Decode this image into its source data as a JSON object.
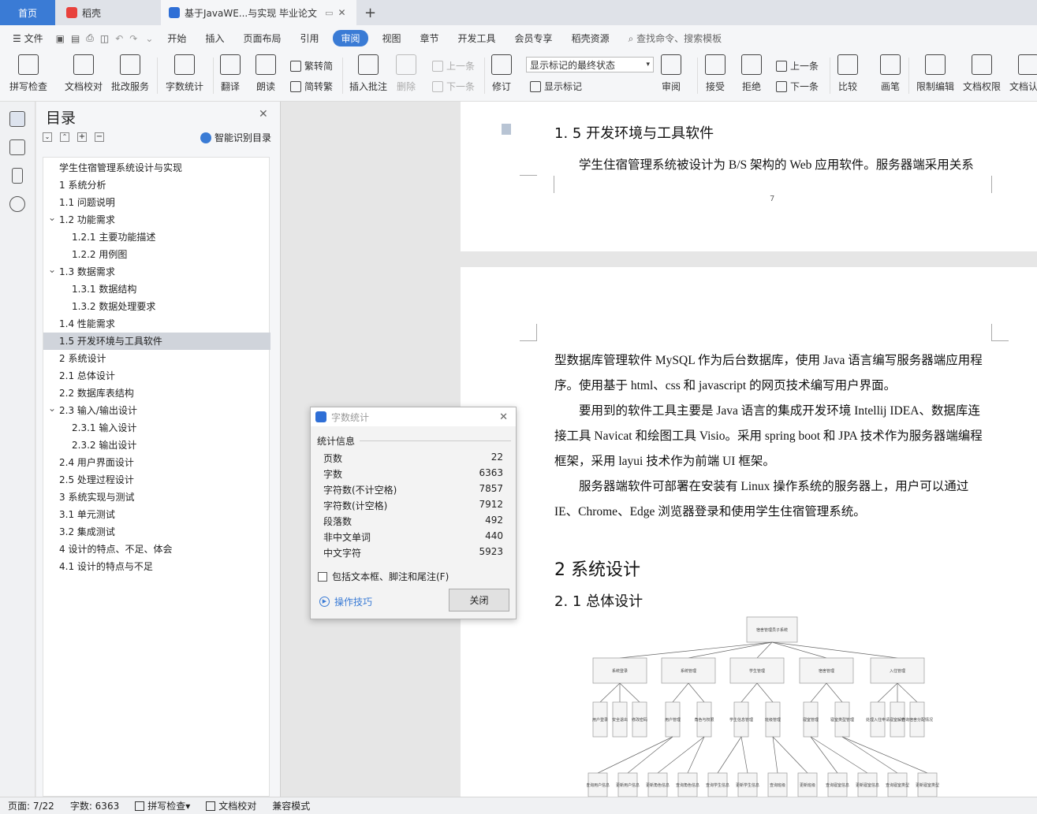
{
  "tabs": {
    "home": "首页",
    "app": "稻壳",
    "doc": "基于JavaWE...与实现 毕业论文"
  },
  "menu": {
    "file": "文件",
    "items": [
      "开始",
      "插入",
      "页面布局",
      "引用",
      "审阅",
      "视图",
      "章节",
      "开发工具",
      "会员专享",
      "稻壳资源"
    ],
    "active_index": 4,
    "search": "查找命令、搜索模板"
  },
  "toolbar": {
    "spell": "拼写检查",
    "proof": "文档校对",
    "batch": "批改服务",
    "wordcount": "字数统计",
    "translate": "翻译",
    "read": "朗读",
    "t2s": "繁转简",
    "s2t": "简转繁",
    "comment": "插入批注",
    "delete": "删除",
    "prev_c": "上一条",
    "next_c": "下一条",
    "revise": "修订",
    "markup_select": "显示标记的最终状态",
    "show_markup": "显示标记",
    "review": "审阅",
    "accept": "接受",
    "reject": "拒绝",
    "prev": "上一条",
    "next": "下一条",
    "compare": "比较",
    "pen": "画笔",
    "restrict": "限制编辑",
    "perm": "文档权限",
    "verify": "文档认证"
  },
  "toc": {
    "title": "目录",
    "smart": "智能识别目录",
    "selected_index": 10,
    "items": [
      {
        "text": "学生住宿管理系统设计与实现",
        "level": 0,
        "arrow": false
      },
      {
        "text": "1 系统分析",
        "level": 0,
        "arrow": false
      },
      {
        "text": "1.1 问题说明",
        "level": 0,
        "arrow": false
      },
      {
        "text": "1.2 功能需求",
        "level": 0,
        "arrow": true
      },
      {
        "text": "1.2.1 主要功能描述",
        "level": 1,
        "arrow": false
      },
      {
        "text": "1.2.2 用例图",
        "level": 1,
        "arrow": false
      },
      {
        "text": "1.3 数据需求",
        "level": 0,
        "arrow": true
      },
      {
        "text": "1.3.1 数据结构",
        "level": 1,
        "arrow": false
      },
      {
        "text": "1.3.2 数据处理要求",
        "level": 1,
        "arrow": false
      },
      {
        "text": "1.4 性能需求",
        "level": 0,
        "arrow": false
      },
      {
        "text": "1.5 开发环境与工具软件",
        "level": 0,
        "arrow": false
      },
      {
        "text": "2 系统设计",
        "level": 0,
        "arrow": false
      },
      {
        "text": "2.1 总体设计",
        "level": 0,
        "arrow": false
      },
      {
        "text": "2.2 数据库表结构",
        "level": 0,
        "arrow": false
      },
      {
        "text": "2.3 输入/输出设计",
        "level": 0,
        "arrow": true
      },
      {
        "text": "2.3.1 输入设计",
        "level": 1,
        "arrow": false
      },
      {
        "text": "2.3.2 输出设计",
        "level": 1,
        "arrow": false
      },
      {
        "text": "2.4 用户界面设计",
        "level": 0,
        "arrow": false
      },
      {
        "text": "2.5 处理过程设计",
        "level": 0,
        "arrow": false
      },
      {
        "text": "3 系统实现与测试",
        "level": 0,
        "arrow": false
      },
      {
        "text": "3.1 单元测试",
        "level": 0,
        "arrow": false
      },
      {
        "text": "3.2 集成测试",
        "level": 0,
        "arrow": false
      },
      {
        "text": "4 设计的特点、不足、体会",
        "level": 0,
        "arrow": false
      },
      {
        "text": "4.1 设计的特点与不足",
        "level": 0,
        "arrow": false
      }
    ]
  },
  "doc": {
    "h15": "1. 5 开发环境与工具软件",
    "p1": "学生住宿管理系统被设计为 B/S 架构的 Web 应用软件。服务器端采用关系",
    "pagenum": "7",
    "p2a": "型数据库管理软件 MySQL 作为后台数据库，使用 Java 语言编写服务器端应用程",
    "p2b": "序。使用基于 html、css 和 javascript 的网页技术编写用户界面。",
    "p3a": "要用到的软件工具主要是 Java 语言的集成开发环境 Intellij IDEA、数据库连",
    "p3b": "接工具 Navicat 和绘图工具 Visio。采用 spring boot 和 JPA 技术作为服务器端编程",
    "p3c": "框架，采用 layui 技术作为前端 UI 框架。",
    "p4a": "服务器端软件可部署在安装有 Linux 操作系统的服务器上，用户可以通过",
    "p4b": "IE、Chrome、Edge 浏览器登录和使用学生住宿管理系统。",
    "h2": "2 系统设计",
    "h21": "2. 1 总体设计"
  },
  "orgchart": {
    "root": "宿舍管理员子系统",
    "l1": [
      "系统登录",
      "系统管理",
      "学生管理",
      "宿舍管理",
      "入住管理"
    ],
    "l2": [
      "用户登录",
      "安全退出",
      "修改密码",
      "用户管理",
      "角色与权限",
      "学生信息管理",
      "班级管理",
      "寝室管理",
      "寝室类型管理",
      "处理入住申请",
      "寝室解约",
      "查询宿舍分配情况"
    ],
    "l3": [
      "查询用户信息",
      "更新用户信息",
      "更新角色信息",
      "查询角色信息",
      "查询学生信息",
      "更新学生信息",
      "查询班级",
      "更新班级",
      "查询寝室信息",
      "更新寝室信息",
      "查询寝室类型",
      "更新寝室类型"
    ]
  },
  "dialog": {
    "title": "字数统计",
    "section": "统计信息",
    "rows": [
      {
        "label": "页数",
        "value": "22"
      },
      {
        "label": "字数",
        "value": "6363"
      },
      {
        "label": "字符数(不计空格)",
        "value": "7857"
      },
      {
        "label": "字符数(计空格)",
        "value": "7912"
      },
      {
        "label": "段落数",
        "value": "492"
      },
      {
        "label": "非中文单词",
        "value": "440"
      },
      {
        "label": "中文字符",
        "value": "5923"
      }
    ],
    "checkbox": "包括文本框、脚注和尾注(F)",
    "tips": "操作技巧",
    "close": "关闭"
  },
  "status": {
    "page": "页面: 7/22",
    "words": "字数: 6363",
    "spell": "拼写检查",
    "proof": "文档校对",
    "compat": "兼容模式"
  },
  "colors": {
    "accent": "#3a7bd5",
    "selected": "#d0d4db"
  }
}
